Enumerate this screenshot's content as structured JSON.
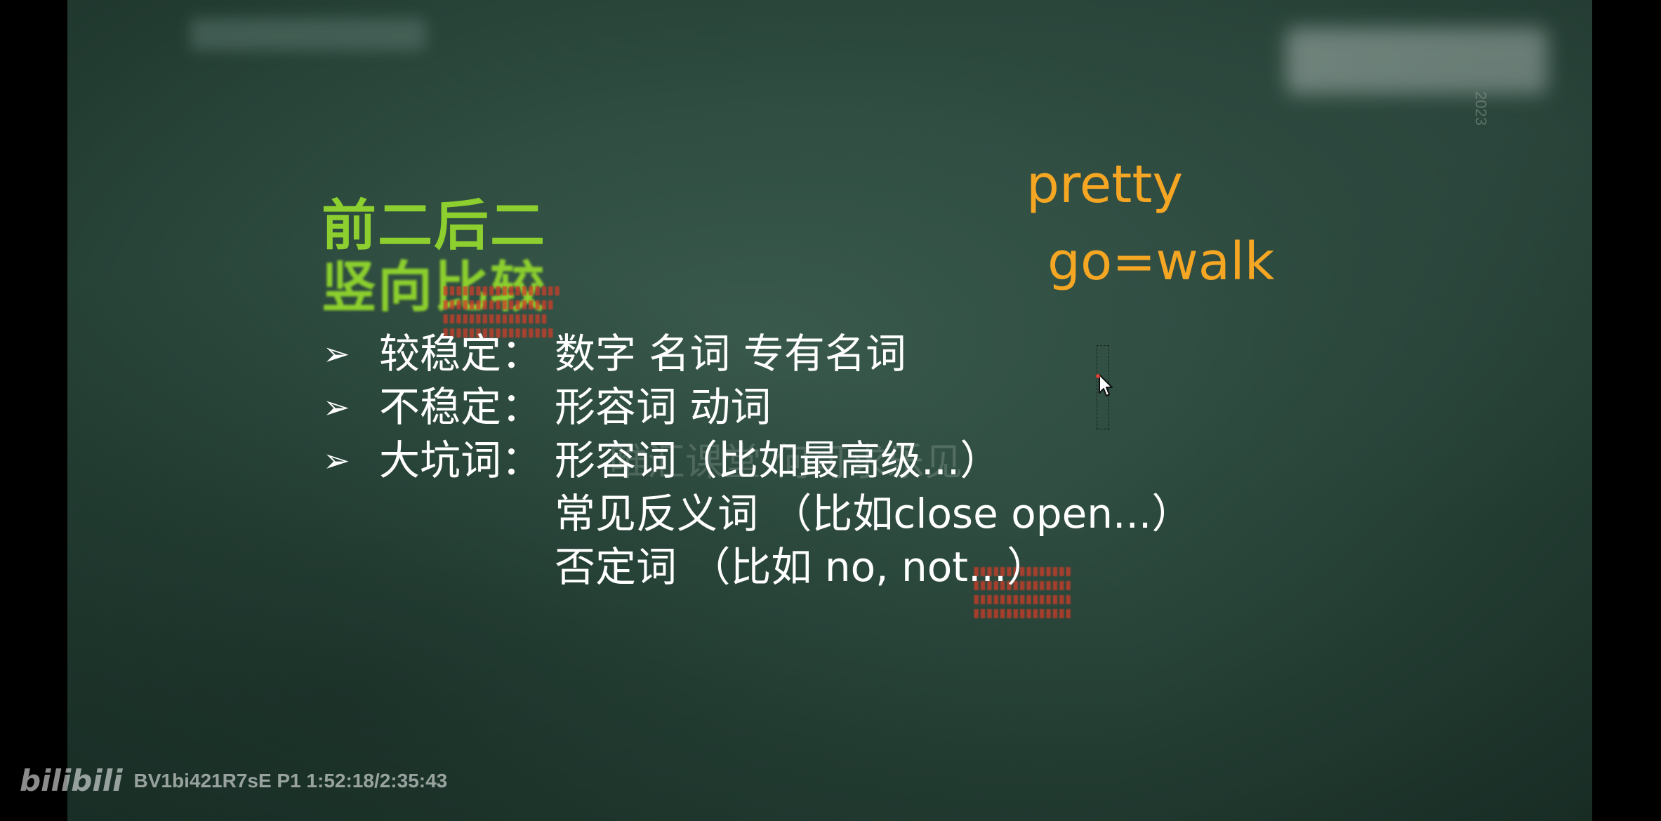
{
  "slide": {
    "title_line1": "前二后二",
    "title_line2": "竖向比较",
    "top_right_year": "2023",
    "orange_word1": "pretty",
    "orange_word2": "go=walk",
    "bullets": [
      {
        "label": "较稳定：",
        "text": "数字  名词  专有名词"
      },
      {
        "label": "不稳定：",
        "text": "形容词  动词"
      },
      {
        "label": "大坑词：",
        "text": "形容词（比如最高级...）"
      }
    ],
    "continuation": [
      "常见反义词  （比如close   open...）",
      "否定词  （比如  no, not...）"
    ],
    "watermark": "唯汇课堂  何可求乐见",
    "colors": {
      "title": "#8ccf2e",
      "orange": "#f5a623",
      "board": "#2f4d41"
    }
  },
  "overlay": {
    "logo": "bilibili",
    "video_info": "BV1bi421R7sE P1 1:52:18/2:35:43"
  },
  "icons": {
    "bullet": "arrow-bullet-icon",
    "cursor": "mouse-pointer-icon"
  }
}
